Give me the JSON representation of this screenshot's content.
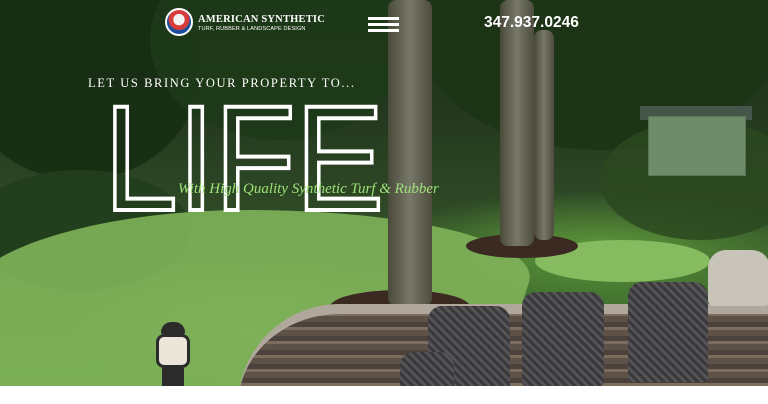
{
  "header": {
    "brand_name": "AMERICAN SYNTHETIC",
    "brand_tagline": "TURF, RUBBER & LANDSCAPE DESIGN",
    "menu_icon": "hamburger-menu-icon",
    "phone": "347.937.0246"
  },
  "hero": {
    "tagline": "LET US BRING YOUR PROPERTY TO...",
    "headline": "LIFE",
    "subheadline": "With High Quality Synthetic Turf & Rubber"
  },
  "colors": {
    "text_primary": "#ffffff",
    "subheadline": "#9ee37a"
  }
}
